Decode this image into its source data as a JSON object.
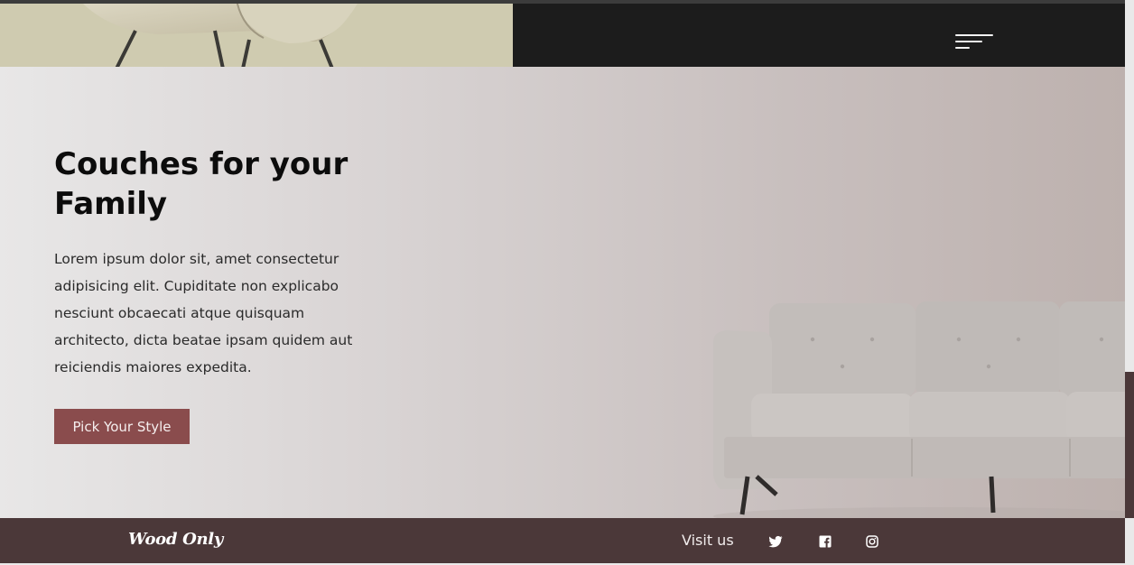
{
  "header": {
    "menu_icon": "hamburger-menu-icon",
    "colors": {
      "left_band": "#cfcbb0",
      "right_band": "#1c1c1c"
    }
  },
  "hero": {
    "title": "Couches for your Family",
    "description": "Lorem ipsum dolor sit, amet consectetur adipisicing elit. Cupiditate non explicabo nesciunt obcaecati atque quisquam architecto, dicta beatae ipsam quidem aut reiciendis maiores expedita.",
    "cta_label": "Pick Your Style",
    "accent": "#8a4c4d"
  },
  "footer": {
    "brand": "Wood Only",
    "visit_label": "Visit us",
    "social_icons": [
      "twitter-icon",
      "facebook-icon",
      "instagram-icon"
    ],
    "background": "#4b3839"
  }
}
